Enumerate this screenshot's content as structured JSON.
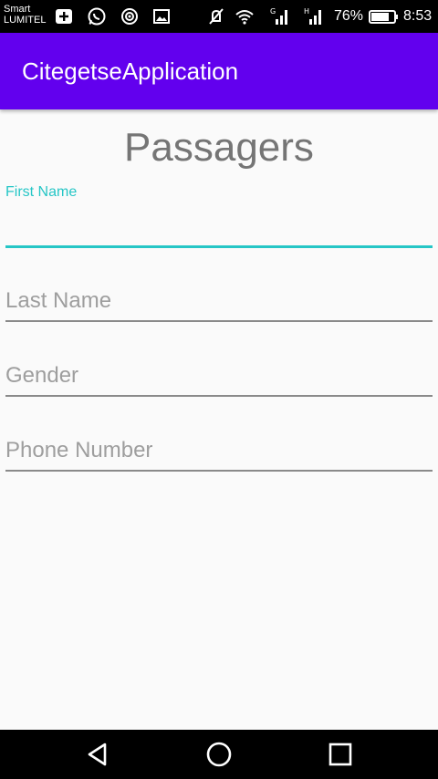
{
  "status_bar": {
    "carrier_line1": "Smart",
    "carrier_line2": "LUMITEL",
    "icons": [
      "add-box-icon",
      "whatsapp-icon",
      "radar-icon",
      "image-icon",
      "mute-icon",
      "wifi-icon",
      "signal-g-icon",
      "signal-h-icon",
      "battery-icon"
    ],
    "network_g": "G",
    "network_h": "H",
    "battery_percent": "76%",
    "time": "8:53"
  },
  "app_bar": {
    "title": "CitegetseApplication",
    "color": "#6200ee"
  },
  "form": {
    "title": "Passagers",
    "accent_color": "#26c6c6",
    "fields": [
      {
        "label": "First Name",
        "value": "",
        "focused": true
      },
      {
        "label": "Last Name",
        "value": "",
        "focused": false
      },
      {
        "label": "Gender",
        "value": "",
        "focused": false
      },
      {
        "label": "Phone Number",
        "value": "",
        "focused": false
      }
    ]
  },
  "nav_bar": {
    "buttons": [
      "back-icon",
      "home-icon",
      "recents-icon"
    ]
  }
}
